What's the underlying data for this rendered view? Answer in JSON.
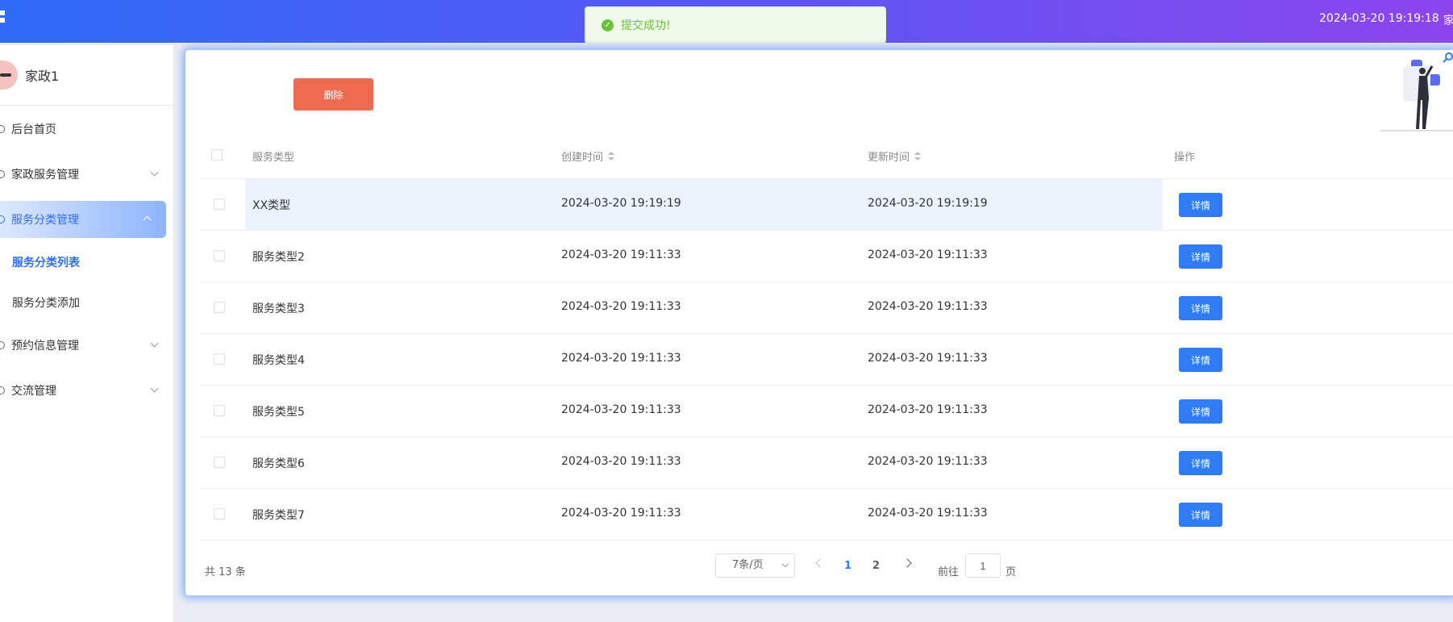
{
  "header": {
    "datetime": "2024-03-20 19:19:18",
    "user_trunc": "家"
  },
  "toast": {
    "message": "提交成功!"
  },
  "sidebar": {
    "profile_name": "家政1",
    "items": [
      {
        "label": "后台首页"
      },
      {
        "label": "家政服务管理"
      },
      {
        "label": "服务分类管理"
      },
      {
        "label": "服务分类列表"
      },
      {
        "label": "服务分类添加"
      },
      {
        "label": "预约信息管理"
      },
      {
        "label": "交流管理"
      }
    ]
  },
  "toolbar": {
    "delete_label": "删除"
  },
  "table": {
    "headers": [
      "服务类型",
      "创建时间",
      "更新时间",
      "操作"
    ],
    "rows": [
      {
        "type": "XX类型",
        "created": "2024-03-20 19:19:19",
        "updated": "2024-03-20 19:19:19",
        "action": "详情"
      },
      {
        "type": "服务类型2",
        "created": "2024-03-20 19:11:33",
        "updated": "2024-03-20 19:11:33",
        "action": "详情"
      },
      {
        "type": "服务类型3",
        "created": "2024-03-20 19:11:33",
        "updated": "2024-03-20 19:11:33",
        "action": "详情"
      },
      {
        "type": "服务类型4",
        "created": "2024-03-20 19:11:33",
        "updated": "2024-03-20 19:11:33",
        "action": "详情"
      },
      {
        "type": "服务类型5",
        "created": "2024-03-20 19:11:33",
        "updated": "2024-03-20 19:11:33",
        "action": "详情"
      },
      {
        "type": "服务类型6",
        "created": "2024-03-20 19:11:33",
        "updated": "2024-03-20 19:11:33",
        "action": "详情"
      },
      {
        "type": "服务类型7",
        "created": "2024-03-20 19:11:33",
        "updated": "2024-03-20 19:11:33",
        "action": "详情"
      }
    ]
  },
  "pagination": {
    "total": "共 13 条",
    "page_size": "7条/页",
    "pages": [
      "1",
      "2"
    ],
    "goto_label": "前往",
    "goto_value": "1",
    "page_unit": "页"
  },
  "colors": {
    "primary": "#2f7cf6",
    "danger": "#ef6b50",
    "success": "#67c23a"
  }
}
